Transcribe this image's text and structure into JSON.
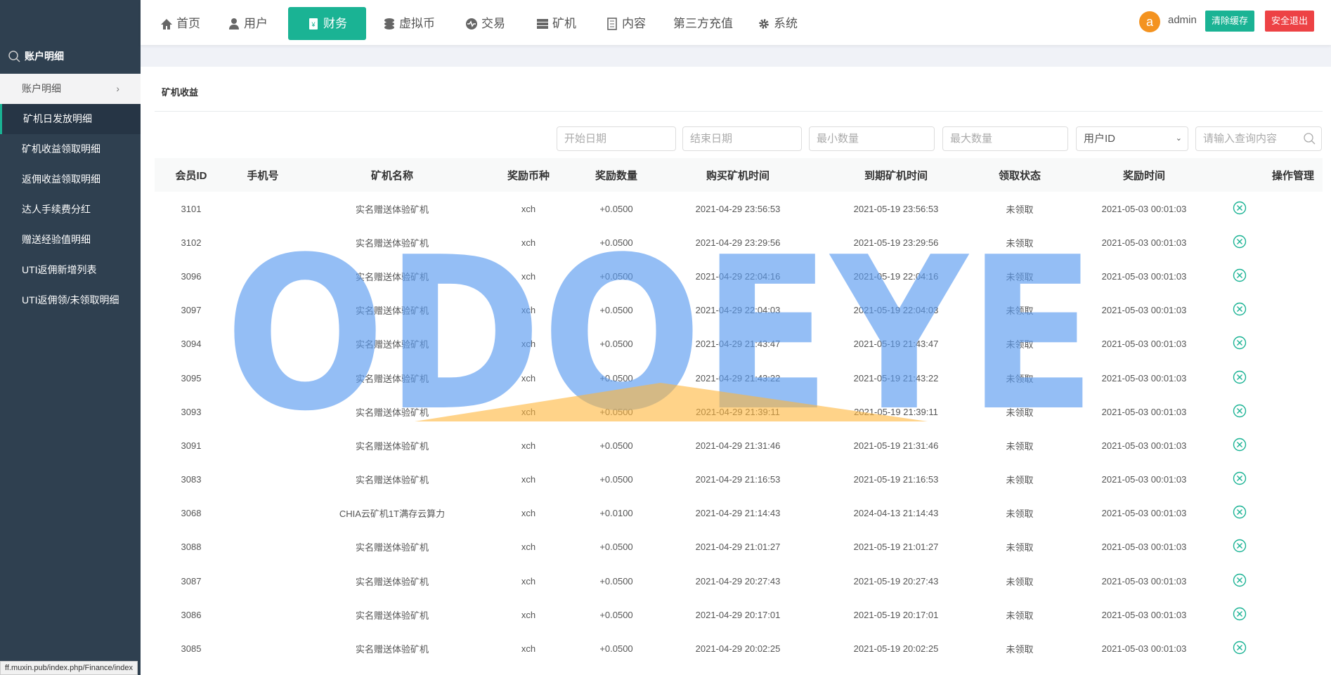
{
  "sidebar": {
    "header": "账户明细",
    "items": [
      {
        "label": "账户明细"
      },
      {
        "label": "矿机日发放明细"
      },
      {
        "label": "矿机收益领取明细"
      },
      {
        "label": "返佣收益领取明细"
      },
      {
        "label": "达人手续费分红"
      },
      {
        "label": "赠送经验值明细"
      },
      {
        "label": "UTI返佣新增列表"
      },
      {
        "label": "UTI返佣领/未领取明细"
      }
    ]
  },
  "nav": [
    {
      "label": "首页",
      "icon": "home-icon"
    },
    {
      "label": "用户",
      "icon": "user-icon"
    },
    {
      "label": "财务",
      "icon": "finance-icon"
    },
    {
      "label": "虚拟币",
      "icon": "database-icon"
    },
    {
      "label": "交易",
      "icon": "exchange-icon"
    },
    {
      "label": "矿机",
      "icon": "server-icon"
    },
    {
      "label": "内容",
      "icon": "document-icon"
    },
    {
      "label": "第三方充值",
      "icon": ""
    },
    {
      "label": "系统",
      "icon": "gear-icon"
    }
  ],
  "user": {
    "avatar": "a",
    "name": "admin",
    "clear_cache": "清除缓存",
    "logout": "安全退出"
  },
  "colors": {
    "accent": "#1ab394",
    "danger": "#ed4245",
    "sidebar": "#2f4050",
    "avatar": "#f49320"
  },
  "page": {
    "title": "矿机收益"
  },
  "filters": {
    "start_date": "开始日期",
    "end_date": "结束日期",
    "min_amount": "最小数量",
    "max_amount": "最大数量",
    "field_select": "用户ID",
    "search_placeholder": "请输入查询内容"
  },
  "table": {
    "columns": [
      "会员ID",
      "手机号",
      "矿机名称",
      "奖励币种",
      "奖励数量",
      "购买矿机时间",
      "到期矿机时间",
      "领取状态",
      "奖励时间",
      "操作管理"
    ],
    "rows": [
      [
        "3101",
        "",
        "实名赠送体验矿机",
        "xch",
        "+0.0500",
        "2021-04-29 23:56:53",
        "2021-05-19 23:56:53",
        "未领取",
        "2021-05-03 00:01:03"
      ],
      [
        "3102",
        "",
        "实名赠送体验矿机",
        "xch",
        "+0.0500",
        "2021-04-29 23:29:56",
        "2021-05-19 23:29:56",
        "未领取",
        "2021-05-03 00:01:03"
      ],
      [
        "3096",
        "",
        "实名赠送体验矿机",
        "xch",
        "+0.0500",
        "2021-04-29 22:04:16",
        "2021-05-19 22:04:16",
        "未领取",
        "2021-05-03 00:01:03"
      ],
      [
        "3097",
        "",
        "实名赠送体验矿机",
        "xch",
        "+0.0500",
        "2021-04-29 22:04:03",
        "2021-05-19 22:04:03",
        "未领取",
        "2021-05-03 00:01:03"
      ],
      [
        "3094",
        "",
        "实名赠送体验矿机",
        "xch",
        "+0.0500",
        "2021-04-29 21:43:47",
        "2021-05-19 21:43:47",
        "未领取",
        "2021-05-03 00:01:03"
      ],
      [
        "3095",
        "",
        "实名赠送体验矿机",
        "xch",
        "+0.0500",
        "2021-04-29 21:43:22",
        "2021-05-19 21:43:22",
        "未领取",
        "2021-05-03 00:01:03"
      ],
      [
        "3093",
        "",
        "实名赠送体验矿机",
        "xch",
        "+0.0500",
        "2021-04-29 21:39:11",
        "2021-05-19 21:39:11",
        "未领取",
        "2021-05-03 00:01:03"
      ],
      [
        "3091",
        "",
        "实名赠送体验矿机",
        "xch",
        "+0.0500",
        "2021-04-29 21:31:46",
        "2021-05-19 21:31:46",
        "未领取",
        "2021-05-03 00:01:03"
      ],
      [
        "3083",
        "",
        "实名赠送体验矿机",
        "xch",
        "+0.0500",
        "2021-04-29 21:16:53",
        "2021-05-19 21:16:53",
        "未领取",
        "2021-05-03 00:01:03"
      ],
      [
        "3068",
        "",
        "CHIA云矿机1T满存云算力",
        "xch",
        "+0.0100",
        "2021-04-29 21:14:43",
        "2024-04-13 21:14:43",
        "未领取",
        "2021-05-03 00:01:03"
      ],
      [
        "3088",
        "",
        "实名赠送体验矿机",
        "xch",
        "+0.0500",
        "2021-04-29 21:01:27",
        "2021-05-19 21:01:27",
        "未领取",
        "2021-05-03 00:01:03"
      ],
      [
        "3087",
        "",
        "实名赠送体验矿机",
        "xch",
        "+0.0500",
        "2021-04-29 20:27:43",
        "2021-05-19 20:27:43",
        "未领取",
        "2021-05-03 00:01:03"
      ],
      [
        "3086",
        "",
        "实名赠送体验矿机",
        "xch",
        "+0.0500",
        "2021-04-29 20:17:01",
        "2021-05-19 20:17:01",
        "未领取",
        "2021-05-03 00:01:03"
      ],
      [
        "3085",
        "",
        "实名赠送体验矿机",
        "xch",
        "+0.0500",
        "2021-04-29 20:02:25",
        "2021-05-19 20:02:25",
        "未领取",
        "2021-05-03 00:01:03"
      ]
    ]
  },
  "watermark": "ODOEYE",
  "status_url": "ff.muxin.pub/index.php/Finance/index"
}
